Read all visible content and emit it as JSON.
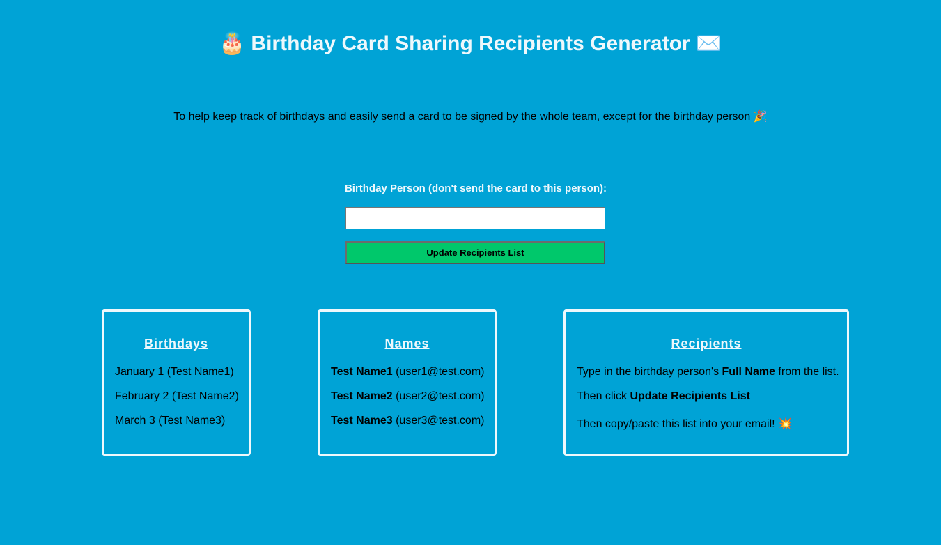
{
  "header": {
    "title_icon": "🎂",
    "title": "Birthday Card Sharing Recipients Generator",
    "title_icon_right": "✉️",
    "subtitle": "To help keep track of birthdays and easily send a card to be signed by the whole team, except for the birthday person",
    "subtitle_icon": "🎉"
  },
  "form": {
    "label": "Birthday Person (don't send the card to this person):",
    "input_value": "",
    "button_label": "Update Recipients List"
  },
  "birthdays": {
    "heading": "Birthdays",
    "items": [
      "January 1 (Test Name1)",
      "February 2 (Test Name2)",
      "March 3 (Test Name3)"
    ]
  },
  "names": {
    "heading": "Names",
    "items": [
      {
        "name": "Test Name1",
        "email": "(user1@test.com)"
      },
      {
        "name": "Test Name2",
        "email": "(user2@test.com)"
      },
      {
        "name": "Test Name3",
        "email": "(user3@test.com)"
      }
    ]
  },
  "recipients": {
    "heading": "Recipients",
    "line1_pre": "Type in the birthday person's ",
    "line1_bold": "Full Name",
    "line1_post": " from the list.",
    "line2_pre": "Then click ",
    "line2_bold": "Update Recipients List",
    "line3": "Then copy/paste this list into your email!",
    "line3_icon": "💥"
  },
  "colors": {
    "background": "#00a3d6",
    "button": "#00c86b",
    "heading_text": "#eef8fc"
  }
}
